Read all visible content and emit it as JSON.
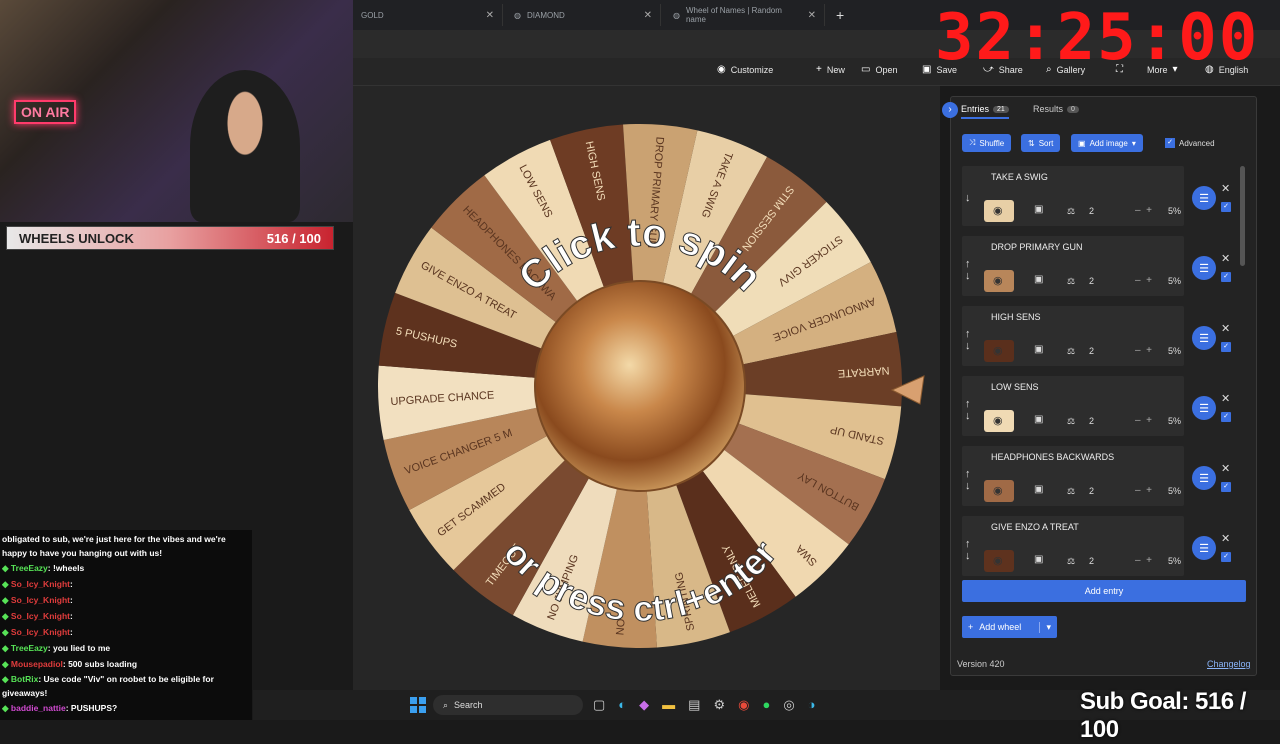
{
  "browser": {
    "tabs": [
      {
        "label": "GOLD"
      },
      {
        "label": "DIAMOND"
      },
      {
        "label": "Wheel of Names | Random name"
      }
    ],
    "new_tab": "+"
  },
  "overlay": {
    "timer": "32:25:00",
    "on_air": "ON AIR",
    "wheels_label": "WHEELS UNLOCK",
    "wheels_count": "516 / 100",
    "wheels_progress": 1.0,
    "sub_goal": "Sub Goal: 516 / 100"
  },
  "toolbar": {
    "customize": "Customize",
    "new": "New",
    "open": "Open",
    "save": "Save",
    "share": "Share",
    "gallery": "Gallery",
    "more": "More",
    "language": "English"
  },
  "wheel": {
    "prompt_top": "Click to spin",
    "prompt_bottom": "or press ctrl+enter",
    "segments": [
      "TAKE A SWIG",
      "STIM SESSION",
      "STICKER GIVV",
      "ANNOUNCER VOICE",
      "NARRATE",
      "STAND UP",
      "BUTTON LAY",
      "SWA",
      "MELEE ONLY",
      "SPRINTING",
      "NO",
      "NO JUMPING",
      "TIMEOUT",
      "GET SCAMMED",
      "VOICE CHANGER 5 M",
      "UPGRADE CHANCE",
      "5 PUSHUPS",
      "GIVE ENZO A TREAT",
      "HEADPHONES BACKWA",
      "LOW SENS",
      "HIGH SENS",
      "DROP PRIMARY GUN"
    ],
    "colors": [
      "#e8cfa6",
      "#8b5a3c",
      "#f0ddb8",
      "#d4b080",
      "#6b3e26",
      "#e0c090",
      "#a47050",
      "#f0d8b0",
      "#5a2f1c",
      "#d8b888",
      "#c09060",
      "#efdcbc",
      "#7a4a30",
      "#e6c89a",
      "#b8865a",
      "#f2e0c0",
      "#5e321e",
      "#dec092",
      "#a06a46",
      "#f0dab4",
      "#6e3c24",
      "#caa272"
    ]
  },
  "panel": {
    "tab_entries": "Entries",
    "entries_count": "21",
    "tab_results": "Results",
    "results_count": "0",
    "shuffle": "Shuffle",
    "sort": "Sort",
    "add_image": "Add image",
    "advanced": "Advanced",
    "entries": [
      {
        "name": "TAKE A SWIG",
        "weight": "2",
        "pct": "5%",
        "color": "#e8cfa6"
      },
      {
        "name": "DROP PRIMARY GUN",
        "weight": "2",
        "pct": "5%",
        "color": "#b8865a"
      },
      {
        "name": "HIGH SENS",
        "weight": "2",
        "pct": "5%",
        "color": "#5a2f1c"
      },
      {
        "name": "LOW SENS",
        "weight": "2",
        "pct": "5%",
        "color": "#f0dab4"
      },
      {
        "name": "HEADPHONES BACKWARDS",
        "weight": "2",
        "pct": "5%",
        "color": "#a06a46"
      },
      {
        "name": "GIVE ENZO A TREAT",
        "weight": "2",
        "pct": "5%",
        "color": "#5e321e"
      }
    ],
    "add_entry": "Add entry",
    "add_wheel": "Add wheel",
    "version": "Version 420",
    "changelog": "Changelog"
  },
  "chat": {
    "intro": "obligated to sub, we're just here for the vibes and we're happy to have you hanging out with us!",
    "messages": [
      {
        "user": "TreeEazy",
        "color": "#57e357",
        "text": ": !wheels"
      },
      {
        "user": "So_Icy_Knight",
        "color": "#e03c3c",
        "text": ": "
      },
      {
        "user": "So_Icy_Knight",
        "color": "#e03c3c",
        "text": ": "
      },
      {
        "user": "So_Icy_Knight",
        "color": "#e03c3c",
        "text": ": "
      },
      {
        "user": "So_Icy_Knight",
        "color": "#e03c3c",
        "text": ": "
      },
      {
        "user": "TreeEazy",
        "color": "#57e357",
        "text": ": you lied to me"
      },
      {
        "user": "Mousepadiol",
        "color": "#e03c3c",
        "text": ": 500 subs loading"
      },
      {
        "user": "BotRix",
        "color": "#57e357",
        "text": ": Use code \"Viv\" on roobet to be eligible for giveaways!"
      },
      {
        "user": "baddie_nattie",
        "color": "#d04ad0",
        "text": ": PUSHUPS?"
      }
    ]
  },
  "taskbar": {
    "search": "Search"
  }
}
